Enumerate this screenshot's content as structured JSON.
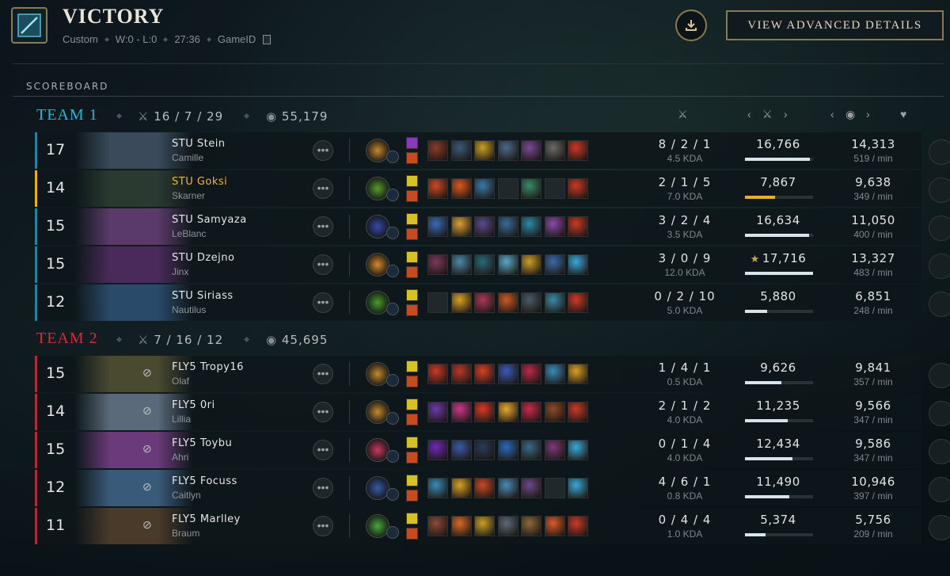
{
  "header": {
    "title": "VICTORY",
    "mode": "Custom",
    "record": "W:0 - L:0",
    "duration": "27:36",
    "game_id_label": "GameID",
    "download_icon": "download-icon",
    "advanced_label": "VIEW ADVANCED DETAILS"
  },
  "scoreboard_label": "SCOREBOARD",
  "teams": [
    {
      "name": "TEAM 1",
      "color": "#27b9d8",
      "kda": "16 / 7 / 29",
      "gold": "55,179",
      "players": [
        {
          "level": "17",
          "name": "STU Stein",
          "champion": "Camille",
          "kda": "8 / 2 / 1",
          "kda_ratio": "4.5 KDA",
          "damage": "16,766",
          "damage_frac": 0.95,
          "gold": "14,313",
          "gpm": "519 / min",
          "accent": "#2a7fa0",
          "highlight": false
        },
        {
          "level": "14",
          "name": "STU Goksi",
          "champion": "Skarner",
          "kda": "2 / 1 / 5",
          "kda_ratio": "7.0 KDA",
          "damage": "7,867",
          "damage_frac": 0.44,
          "gold": "9,638",
          "gpm": "349 / min",
          "accent": "#e8b020",
          "highlight": true
        },
        {
          "level": "15",
          "name": "STU Samyaza",
          "champion": "LeBlanc",
          "kda": "3 / 2 / 4",
          "kda_ratio": "3.5 KDA",
          "damage": "16,634",
          "damage_frac": 0.94,
          "gold": "11,050",
          "gpm": "400 / min",
          "accent": "#2a7fa0",
          "highlight": false
        },
        {
          "level": "15",
          "name": "STU Dzejno",
          "champion": "Jinx",
          "kda": "3 / 0 / 9",
          "kda_ratio": "12.0 KDA",
          "damage": "17,716",
          "damage_frac": 1.0,
          "gold": "13,327",
          "gpm": "483 / min",
          "accent": "#2a7fa0",
          "highlight": false,
          "star": true
        },
        {
          "level": "12",
          "name": "STU Siriass",
          "champion": "Nautilus",
          "kda": "0 / 2 / 10",
          "kda_ratio": "5.0 KDA",
          "damage": "5,880",
          "damage_frac": 0.33,
          "gold": "6,851",
          "gpm": "248 / min",
          "accent": "#2a7fa0",
          "highlight": false
        }
      ]
    },
    {
      "name": "TEAM 2",
      "color": "#d8293f",
      "kda": "7 / 16 / 12",
      "gold": "45,695",
      "players": [
        {
          "level": "15",
          "name": "FLY5 Tropy16",
          "champion": "Olaf",
          "kda": "1 / 4 / 1",
          "kda_ratio": "0.5 KDA",
          "damage": "9,626",
          "damage_frac": 0.54,
          "gold": "9,841",
          "gpm": "357 / min",
          "accent": "#b02a3a",
          "highlight": false
        },
        {
          "level": "14",
          "name": "FLY5 0ri",
          "champion": "Lillia",
          "kda": "2 / 1 / 2",
          "kda_ratio": "4.0 KDA",
          "damage": "11,235",
          "damage_frac": 0.63,
          "gold": "9,566",
          "gpm": "347 / min",
          "accent": "#b02a3a",
          "highlight": false
        },
        {
          "level": "15",
          "name": "FLY5 Toybu",
          "champion": "Ahri",
          "kda": "0 / 1 / 4",
          "kda_ratio": "4.0 KDA",
          "damage": "12,434",
          "damage_frac": 0.7,
          "gold": "9,586",
          "gpm": "347 / min",
          "accent": "#b02a3a",
          "highlight": false
        },
        {
          "level": "12",
          "name": "FLY5 Focuss",
          "champion": "Caitlyn",
          "kda": "4 / 6 / 1",
          "kda_ratio": "0.8 KDA",
          "damage": "11,490",
          "damage_frac": 0.65,
          "gold": "10,946",
          "gpm": "397 / min",
          "accent": "#b02a3a",
          "highlight": false
        },
        {
          "level": "11",
          "name": "FLY5 Marlley",
          "champion": "Braum",
          "kda": "0 / 4 / 4",
          "kda_ratio": "1.0 KDA",
          "damage": "5,374",
          "damage_frac": 0.3,
          "gold": "5,756",
          "gpm": "209 / min",
          "accent": "#b02a3a",
          "highlight": false
        }
      ]
    }
  ]
}
